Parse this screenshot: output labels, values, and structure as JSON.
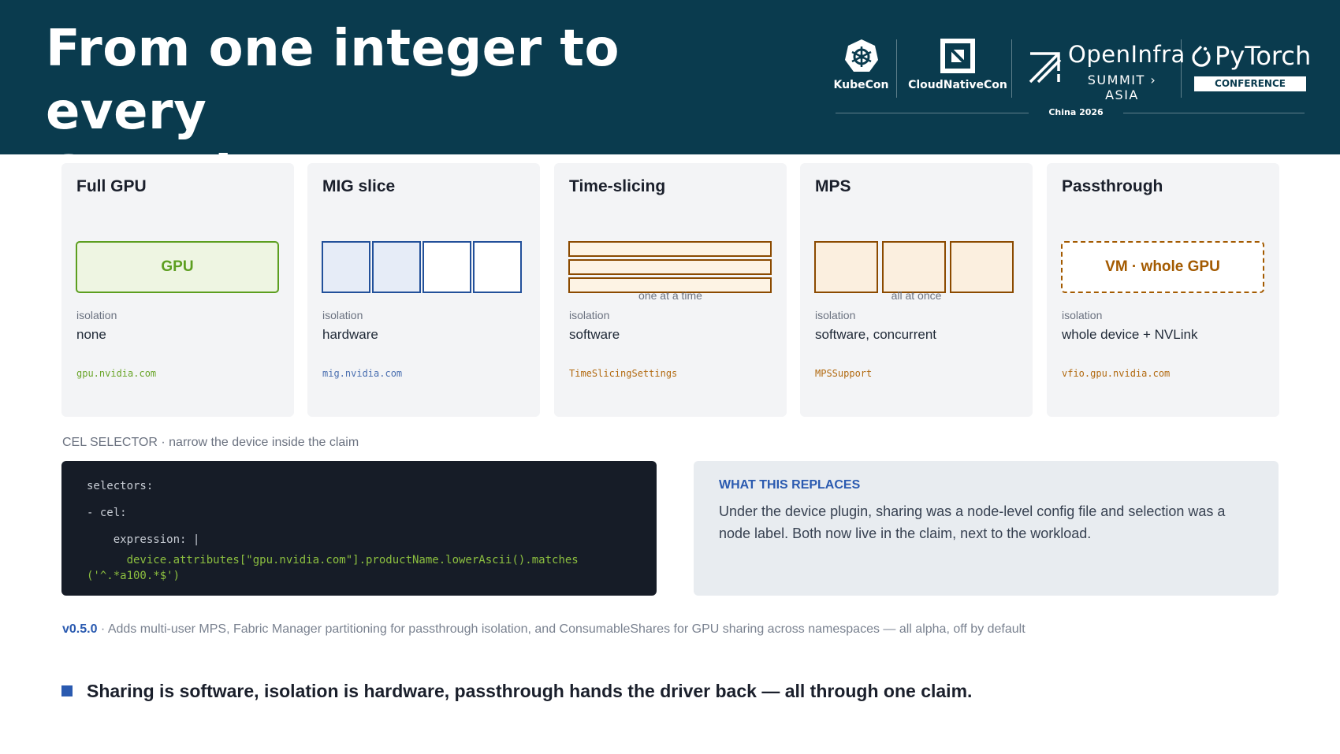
{
  "header": {
    "title_line1": "From one integer to every",
    "title_line2": "GPU shape",
    "logos": {
      "kubecon": "KubeCon",
      "cloudnativecon": "CloudNativeCon",
      "openinfra": "OpenInfra",
      "openinfra_sub": "SUMMIT › ASIA",
      "pytorch": "PyTorch",
      "pytorch_sub": "CONFERENCE",
      "location": "China 2026"
    }
  },
  "cards": [
    {
      "title": "Full GPU",
      "viz_label": "GPU",
      "caption": "",
      "isolation_label": "isolation",
      "isolation_value": "none",
      "api": "gpu.nvidia.com",
      "api_color": "#6aa52a"
    },
    {
      "title": "MIG slice",
      "caption": "",
      "isolation_label": "isolation",
      "isolation_value": "hardware",
      "api": "mig.nvidia.com",
      "api_color": "#4a6fb0"
    },
    {
      "title": "Time-slicing",
      "caption": "one at a time",
      "isolation_label": "isolation",
      "isolation_value": "software",
      "api": "TimeSlicingSettings",
      "api_color": "#b26a10"
    },
    {
      "title": "MPS",
      "caption": "all at once",
      "isolation_label": "isolation",
      "isolation_value": "software, concurrent",
      "api": "MPSSupport",
      "api_color": "#b26a10"
    },
    {
      "title": "Passthrough",
      "viz_label": "VM · whole GPU",
      "caption": "",
      "isolation_label": "isolation",
      "isolation_value": "whole device + NVLink",
      "api": "vfio.gpu.nvidia.com",
      "api_color": "#b26a10"
    }
  ],
  "cel": {
    "caption": "CEL SELECTOR · narrow the device inside the claim",
    "lines": [
      "selectors:",
      "- cel:",
      "    expression: |",
      "      device.attributes[\"gpu.nvidia.com\"].productName.lowerAscii().matches",
      "('^.*a100.*$')"
    ]
  },
  "replaces": {
    "title": "WHAT THIS REPLACES",
    "body": "Under the device plugin, sharing was a node-level config file and selection was a node label. Both now live in the claim, next to the workload."
  },
  "version": {
    "tag": "v0.5.0",
    "text": " · Adds multi-user MPS, Fabric Manager partitioning for passthrough isolation, and ConsumableShares for GPU sharing across namespaces — all alpha, off by default"
  },
  "takeaway": "Sharing is software, isolation is hardware, passthrough hands the driver back — all through one claim.",
  "colors": {
    "header_bg": "#0a3b4e",
    "accent_blue": "#2a5ab0",
    "gpu_green": "#5c9e1f",
    "mig_blue": "#22509a",
    "sharing_brown": "#8b4a00"
  }
}
